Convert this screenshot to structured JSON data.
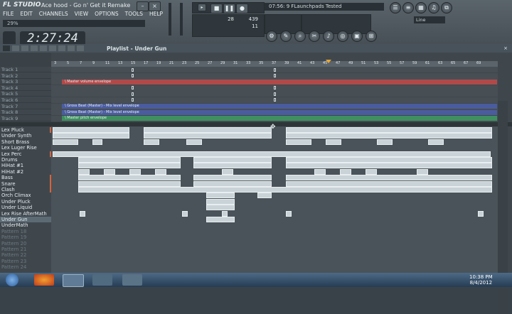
{
  "window": {
    "logo": "FL STUDIO",
    "song_title": "Ace hood - Go n' Get it Remake"
  },
  "menu": [
    "FILE",
    "EDIT",
    "CHANNELS",
    "VIEW",
    "OPTIONS",
    "TOOLS",
    "HELP"
  ],
  "hint": "29%",
  "time": "2:27:24",
  "hint2": "07:56: 9 FLaunchpads Tested",
  "tempo": {
    "bpm": "439",
    "value": "28",
    "small": "11"
  },
  "snap": "Line",
  "playlist": {
    "title": "Playlist - Under Gun"
  },
  "ruler_ticks": [
    "3",
    "5",
    "7",
    "9",
    "11",
    "13",
    "15",
    "17",
    "19",
    "21",
    "23",
    "25",
    "27",
    "29",
    "31",
    "33",
    "35",
    "37",
    "39",
    "41",
    "43",
    "45",
    "47",
    "49",
    "51",
    "53",
    "55",
    "57",
    "59",
    "61",
    "63",
    "65",
    "67",
    "69"
  ],
  "tracks": [
    "Track 1",
    "Track 2",
    "Track 3",
    "Track 4",
    "Track 5",
    "Track 6",
    "Track 7",
    "Track 8",
    "Track 9"
  ],
  "envelopes": {
    "t3": "\\ Master volume envelope",
    "t7": "\\ Gross Beat (Master) - Mix level envelope",
    "t8": "\\ Gross Beat (Master) - Mix level envelope",
    "t9": "\\ Master pitch envelope"
  },
  "patterns": [
    "Lex Pluck",
    "Under Synth",
    "Short Brass",
    "Lex Luger Rise",
    "Lex Perc",
    "Drums",
    "HiHat #1",
    "HiHat #2",
    "Bass",
    "Snare",
    "Clash",
    "Orch Climax",
    "Under Pluck",
    "Under Liquid",
    "Lex Rise AfterMath",
    "Under Gun",
    "UnderMath",
    "Pattern 18",
    "Pattern 19",
    "Pattern 20",
    "Pattern 21",
    "Pattern 22",
    "Pattern 23",
    "Pattern 24"
  ],
  "colors": {
    "env_red": "#b04a4a",
    "env_blue": "#4b5c9e",
    "env_green": "#3f8f60",
    "selected": "#5c6a74"
  },
  "clock": {
    "time": "10:38 PM",
    "date": "8/4/2012"
  }
}
